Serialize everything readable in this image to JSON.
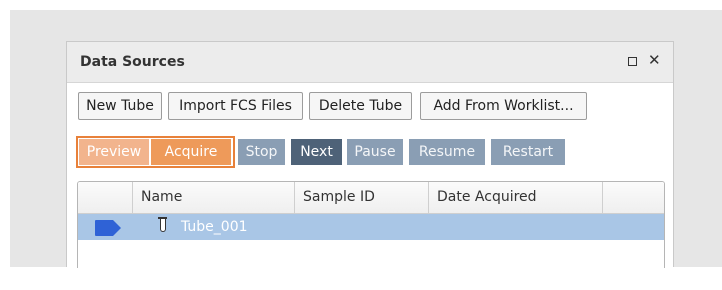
{
  "panel": {
    "title": "Data Sources"
  },
  "toolbar": {
    "new_tube": "New Tube",
    "import_fcs": "Import FCS Files",
    "delete_tube": "Delete Tube",
    "add_from_worklist": "Add From Worklist..."
  },
  "acquisition": {
    "preview": "Preview",
    "acquire": "Acquire",
    "stop": "Stop",
    "next": "Next",
    "pause": "Pause",
    "resume": "Resume",
    "restart": "Restart"
  },
  "grid": {
    "columns": [
      "Name",
      "Sample ID",
      "Date Acquired"
    ],
    "rows": [
      {
        "name": "Tube_001",
        "sample_id": "",
        "date_acquired": "",
        "selected": true
      }
    ]
  },
  "colors": {
    "acquire_border": "#e8813a",
    "selected_row": "#a9c6e6",
    "current_arrow": "#2f62d6"
  },
  "icons": {
    "maximize": "maximize-icon",
    "close": "close-icon",
    "current_row": "current-tube-arrow-icon",
    "tube": "tube-icon"
  }
}
